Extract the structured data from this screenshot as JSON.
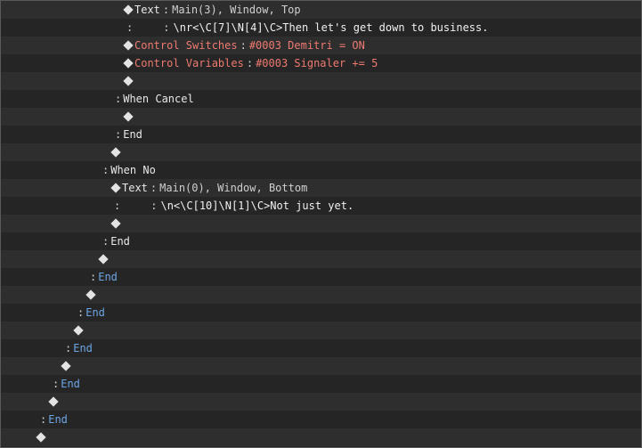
{
  "event_list": {
    "rows": [
      {
        "type": "command",
        "indent": 137,
        "label": "Text",
        "label_color": "white",
        "params": "Main(3), Window, Top"
      },
      {
        "type": "continuation",
        "indent": 137,
        "text": "\\nr<\\C[7]\\N[4]\\C>Then let's get down to business."
      },
      {
        "type": "command",
        "indent": 137,
        "label": "Control Switches",
        "label_color": "red",
        "params": "#0003 Demitri = ON"
      },
      {
        "type": "command",
        "indent": 137,
        "label": "Control Variables",
        "label_color": "red",
        "params": "#0003 Signaler += 5"
      },
      {
        "type": "empty",
        "indent": 137
      },
      {
        "type": "branch",
        "indent": 128,
        "label": "When Cancel",
        "label_color": "white"
      },
      {
        "type": "empty",
        "indent": 137
      },
      {
        "type": "branch",
        "indent": 128,
        "label": "End",
        "label_color": "white"
      },
      {
        "type": "empty",
        "indent": 123
      },
      {
        "type": "branch",
        "indent": 114,
        "label": "When No",
        "label_color": "white"
      },
      {
        "type": "command",
        "indent": 123,
        "label": "Text",
        "label_color": "white",
        "params": "Main(0), Window, Bottom"
      },
      {
        "type": "continuation",
        "indent": 123,
        "text": "\\n<\\C[10]\\N[1]\\C>Not just yet."
      },
      {
        "type": "empty",
        "indent": 123
      },
      {
        "type": "branch",
        "indent": 114,
        "label": "End",
        "label_color": "white"
      },
      {
        "type": "empty",
        "indent": 109
      },
      {
        "type": "branch",
        "indent": 100,
        "label": "End",
        "label_color": "blue"
      },
      {
        "type": "empty",
        "indent": 95
      },
      {
        "type": "branch",
        "indent": 86,
        "label": "End",
        "label_color": "blue"
      },
      {
        "type": "empty",
        "indent": 81
      },
      {
        "type": "branch",
        "indent": 72,
        "label": "End",
        "label_color": "blue"
      },
      {
        "type": "empty",
        "indent": 67
      },
      {
        "type": "branch",
        "indent": 58,
        "label": "End",
        "label_color": "blue"
      },
      {
        "type": "empty",
        "indent": 53
      },
      {
        "type": "branch",
        "indent": 44,
        "label": "End",
        "label_color": "blue"
      },
      {
        "type": "empty",
        "indent": 39
      }
    ]
  }
}
